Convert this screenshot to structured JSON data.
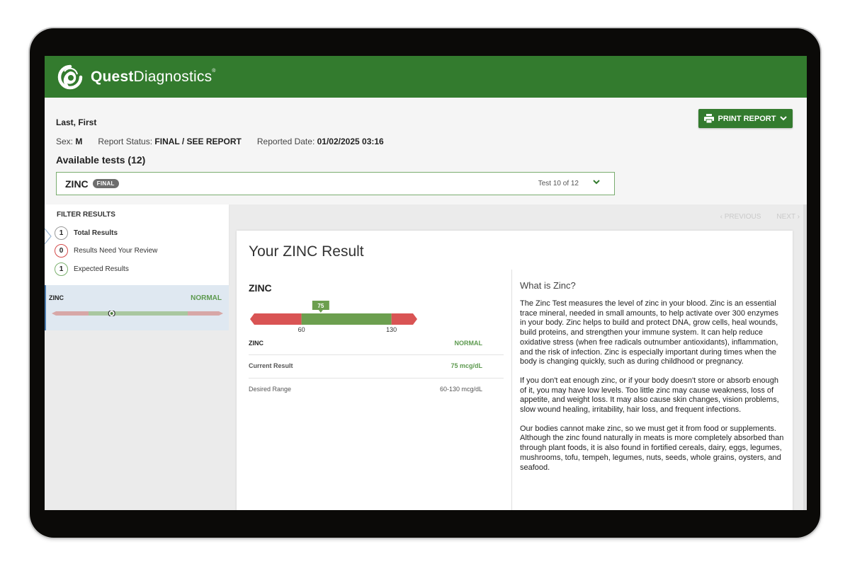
{
  "brand": {
    "name_bold": "Quest",
    "name_light": "Diagnostics",
    "trademark": "®",
    "header_color": "#337b2e"
  },
  "patient": {
    "name": "Last, First",
    "sex_label": "Sex:",
    "sex_value": "M",
    "status_label": "Report Status:",
    "status_value": "FINAL / SEE REPORT",
    "date_label": "Reported Date:",
    "date_value": "01/02/2025 03:16"
  },
  "available_tests_label": "Available tests (12)",
  "print_button": {
    "label": "PRINT REPORT",
    "icon": "printer-icon"
  },
  "test_select": {
    "name": "ZINC",
    "badge": "FINAL",
    "position": "Test 10 of 12"
  },
  "filter": {
    "title": "FILTER RESULTS",
    "items": [
      {
        "count": "1",
        "label": "Total Results",
        "active": true,
        "color": "#999999"
      },
      {
        "count": "0",
        "label": "Results Need Your Review",
        "active": false,
        "color": "#d44a4a"
      },
      {
        "count": "1",
        "label": "Expected Results",
        "active": false,
        "color": "#7bb06d"
      }
    ]
  },
  "sidebar_result": {
    "name": "ZINC",
    "status": "NORMAL",
    "value_fraction": 0.35
  },
  "pager": {
    "previous": "PREVIOUS",
    "next": "NEXT"
  },
  "result": {
    "title": "Your ZINC Result",
    "analyte": "ZINC",
    "gauge": {
      "value": 75,
      "value_label": "75",
      "low": 60,
      "high": 130,
      "low_label": "60",
      "high_label": "130",
      "min": 20,
      "max": 150,
      "out_of_range_color": "#d95454",
      "in_range_color": "#6c9f4f"
    },
    "rows": {
      "analyte_label": "ZINC",
      "analyte_status": "NORMAL",
      "current_label": "Current Result",
      "current_value": "75 mcg/dL",
      "range_label": "Desired Range",
      "range_value": "60-130 mcg/dL"
    }
  },
  "info": {
    "heading": "What is Zinc?",
    "paragraphs": [
      "The Zinc Test measures the level of zinc in your blood. Zinc is an essential trace mineral, needed in small amounts, to help activate over 300 enzymes in your body. Zinc helps to build and protect DNA, grow cells, heal wounds, build proteins, and strengthen your immune system. It can help reduce oxidative stress (when free radicals outnumber antioxidants), inflammation, and the risk of infection. Zinc is especially important during times when the body is changing quickly, such as during childhood or pregnancy.",
      "If you don't eat enough zinc, or if your body doesn't store or absorb enough of it, you may have low levels. Too little zinc may cause weakness, loss of appetite, and weight loss. It may also cause skin changes, vision problems, slow wound healing, irritability, hair loss, and frequent infections.",
      "Our bodies cannot make zinc, so we must get it from food or supplements. Although the zinc found naturally in meats is more completely absorbed than through plant foods, it is also found in fortified cereals, dairy, eggs, legumes, mushrooms, tofu, tempeh, legumes, nuts, seeds, whole grains, oysters, and seafood."
    ]
  }
}
